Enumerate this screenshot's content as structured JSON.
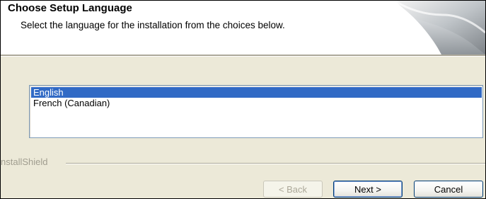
{
  "header": {
    "title": "Choose Setup Language",
    "subtitle": "Select the language for the installation from the choices below."
  },
  "languages": {
    "selected_index": 0,
    "items": [
      {
        "label": "English",
        "selected": true
      },
      {
        "label": "French (Canadian)",
        "selected": false
      }
    ]
  },
  "footer": {
    "brand": "nstallShield",
    "buttons": {
      "back": {
        "label": "< Back",
        "enabled": false
      },
      "next": {
        "label": "Next >",
        "enabled": true
      },
      "cancel": {
        "label": "Cancel",
        "enabled": true
      }
    }
  },
  "colors": {
    "selection": "#316ac5",
    "dialog_background": "#ece9d8",
    "header_background": "#ffffff"
  }
}
